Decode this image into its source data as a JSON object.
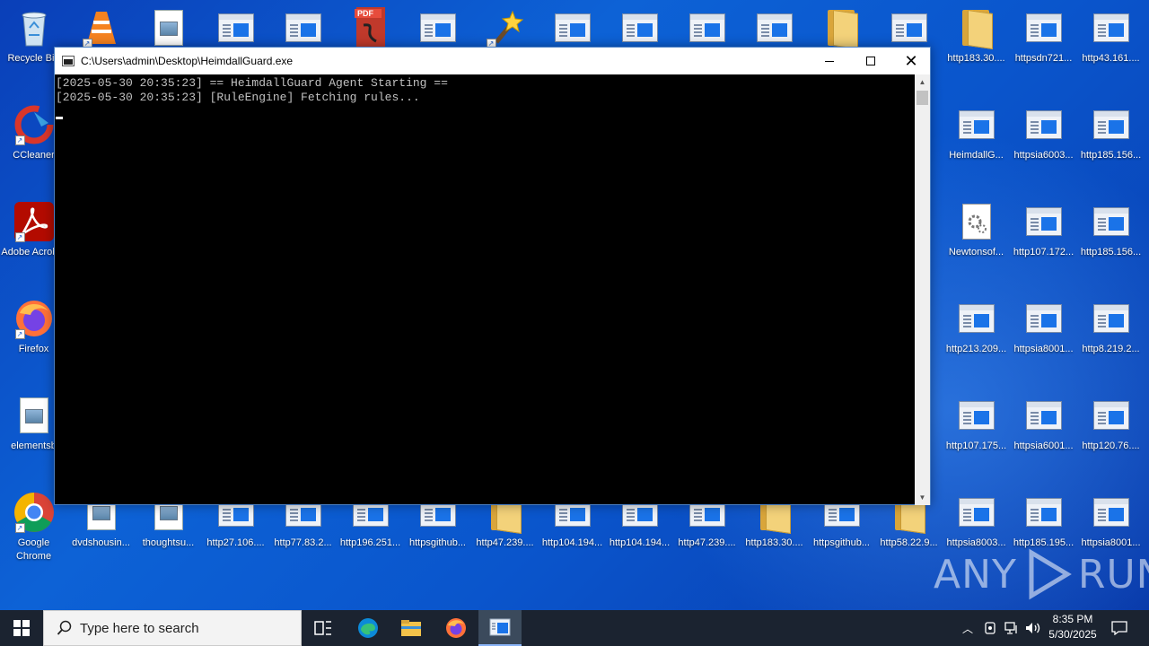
{
  "desktop_icons": {
    "left_column": [
      {
        "label": "Recycle Bin",
        "icon": "recycle-bin-icon"
      },
      {
        "label": "CCleaner",
        "icon": "ccleaner-icon"
      },
      {
        "label": "Adobe Acrobat",
        "icon": "adobe-acrobat-icon"
      },
      {
        "label": "Firefox",
        "icon": "firefox-icon"
      },
      {
        "label": "elementsb",
        "icon": "image-file-icon"
      },
      {
        "label": "Google Chrome",
        "icon": "chrome-icon"
      }
    ],
    "right_grid": [
      [
        "http183.30....",
        "httpsdn721...",
        "http43.161...."
      ],
      [
        "HeimdallG...",
        "httpsia6003...",
        "http185.156..."
      ],
      [
        "Newtonsof...",
        "http107.172...",
        "http185.156..."
      ],
      [
        "http213.209...",
        "httpsia8001...",
        "http8.219.2..."
      ],
      [
        "http107.175...",
        "httpsia6001...",
        "http120.76...."
      ],
      [
        "httpsia8003...",
        "http185.195...",
        "httpsia8001..."
      ]
    ],
    "bottom_row": [
      "dvdshousin...",
      "thoughtsu...",
      "http27.106....",
      "http77.83.2...",
      "http196.251...",
      "httpsgithub...",
      "http47.239....",
      "http104.194...",
      "http104.194...",
      "http47.239....",
      "http183.30....",
      "httpsgithub...",
      "http58.22.9..."
    ]
  },
  "console": {
    "title": "C:\\Users\\admin\\Desktop\\HeimdallGuard.exe",
    "lines": [
      "[2025-05-30 20:35:23] == HeimdallGuard Agent Starting ==",
      "[2025-05-30 20:35:23] [RuleEngine] Fetching rules..."
    ]
  },
  "watermark": {
    "left": "ANY",
    "right": "RUN"
  },
  "taskbar": {
    "search_placeholder": "Type here to search",
    "clock_time": "8:35 PM",
    "clock_date": "5/30/2025"
  },
  "colors": {
    "desktop": "#0d62d6",
    "taskbar": "#1b2330",
    "console_bg": "#000000",
    "console_text": "#c0c0c0"
  }
}
